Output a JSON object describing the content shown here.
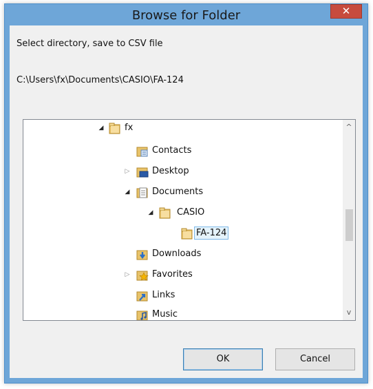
{
  "window": {
    "title": "Browse for Folder",
    "close_glyph": "✕"
  },
  "dialog": {
    "instruction": "Select directory, save to CSV file",
    "path": "C:\\Users\\fx\\Documents\\CASIO\\FA-124"
  },
  "tree": {
    "items": [
      {
        "label": "fx",
        "icon": "user-folder-icon",
        "expander": "expanded"
      },
      {
        "label": "Contacts",
        "icon": "contacts-folder-icon",
        "expander": "none"
      },
      {
        "label": "Desktop",
        "icon": "desktop-folder-icon",
        "expander": "collapsed"
      },
      {
        "label": "Documents",
        "icon": "documents-folder-icon",
        "expander": "expanded"
      },
      {
        "label": "CASIO",
        "icon": "folder-icon",
        "expander": "expanded"
      },
      {
        "label": "FA-124",
        "icon": "folder-icon",
        "expander": "none",
        "selected": true
      },
      {
        "label": "Downloads",
        "icon": "downloads-folder-icon",
        "expander": "none"
      },
      {
        "label": "Favorites",
        "icon": "favorites-folder-icon",
        "expander": "collapsed"
      },
      {
        "label": "Links",
        "icon": "links-folder-icon",
        "expander": "none"
      },
      {
        "label": "Music",
        "icon": "music-folder-icon",
        "expander": "none"
      }
    ],
    "expanded_glyph": "◢",
    "collapsed_glyph": "▷",
    "scroll_up_glyph": "^",
    "scroll_down_glyph": "v"
  },
  "buttons": {
    "ok_label": "OK",
    "cancel_label": "Cancel"
  },
  "colors": {
    "frame": "#6ea6d8",
    "close_button": "#c74b3d",
    "selection_border": "#7db8e8",
    "selection_fill": "#e5f3fb"
  }
}
